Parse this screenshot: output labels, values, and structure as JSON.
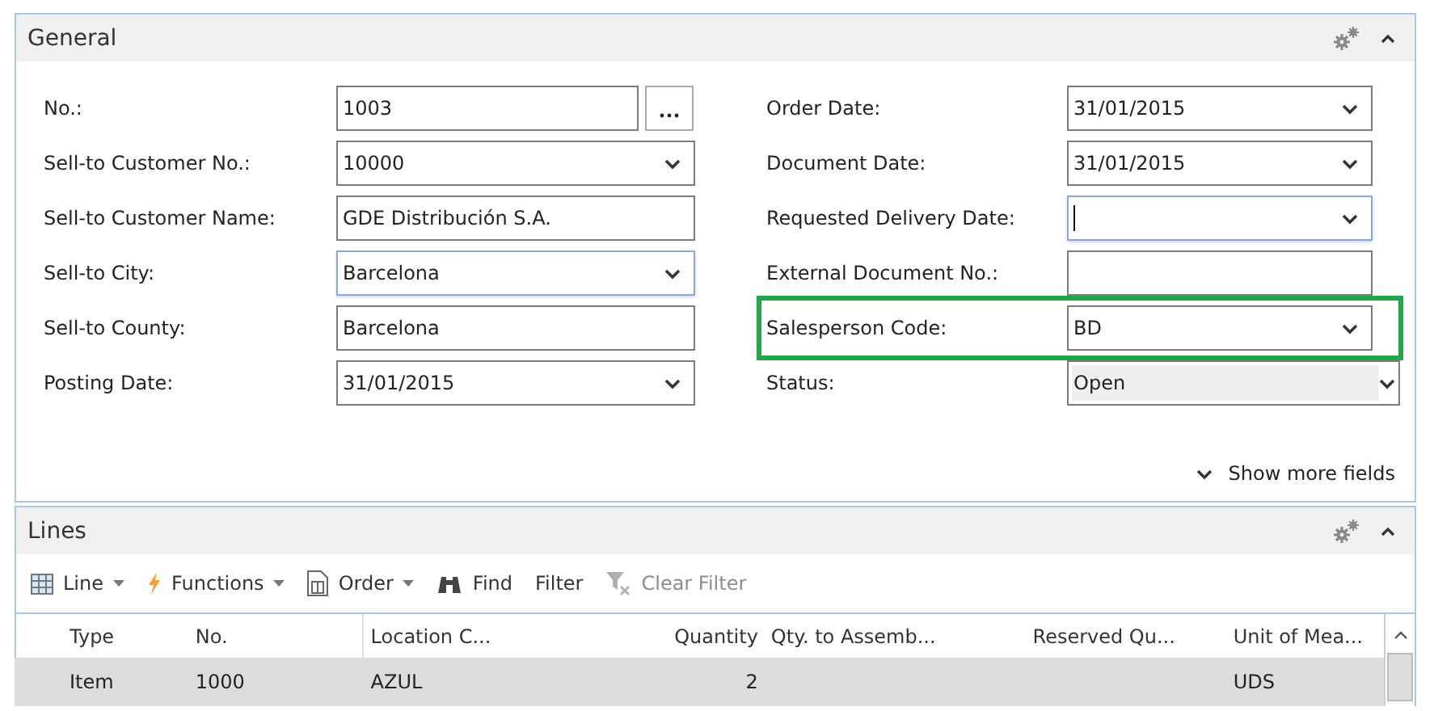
{
  "general": {
    "title": "General",
    "left_fields": [
      {
        "label": "No.:",
        "value": "1003",
        "kind": "lookup",
        "focused": false,
        "readonly": false,
        "highlighted": false
      },
      {
        "label": "Sell-to Customer No.:",
        "value": "10000",
        "kind": "dropdown",
        "focused": false,
        "readonly": false,
        "highlighted": false
      },
      {
        "label": "Sell-to Customer Name:",
        "value": "GDE Distribución S.A.",
        "kind": "text",
        "focused": false,
        "readonly": false,
        "highlighted": false
      },
      {
        "label": "Sell-to City:",
        "value": "Barcelona",
        "kind": "dropdown",
        "focused": true,
        "readonly": false,
        "highlighted": false
      },
      {
        "label": "Sell-to County:",
        "value": "Barcelona",
        "kind": "text",
        "focused": false,
        "readonly": false,
        "highlighted": false
      },
      {
        "label": "Posting Date:",
        "value": "31/01/2015",
        "kind": "dropdown",
        "focused": false,
        "readonly": false,
        "highlighted": false
      }
    ],
    "right_fields": [
      {
        "label": "Order Date:",
        "value": "31/01/2015",
        "kind": "dropdown",
        "focused": false,
        "readonly": false,
        "highlighted": false
      },
      {
        "label": "Document Date:",
        "value": "31/01/2015",
        "kind": "dropdown",
        "focused": false,
        "readonly": false,
        "highlighted": false
      },
      {
        "label": "Requested Delivery Date:",
        "kind": "dropdown",
        "focused": true,
        "readonly": false,
        "highlighted": false
      },
      {
        "label": "External Document No.:",
        "kind": "text",
        "focused": false,
        "readonly": false,
        "highlighted": false
      },
      {
        "label": "Salesperson Code:",
        "value": "BD",
        "kind": "dropdown",
        "focused": false,
        "readonly": false,
        "highlighted": true
      },
      {
        "label": "Status:",
        "value": "Open",
        "kind": "dropdown",
        "focused": false,
        "readonly": true,
        "highlighted": false
      }
    ],
    "show_more": "Show more fields"
  },
  "lines": {
    "title": "Lines",
    "toolbar": [
      {
        "label": "Line",
        "kind": "grid",
        "dropdown": true,
        "disabled": false
      },
      {
        "label": "Functions",
        "kind": "bolt",
        "dropdown": true,
        "disabled": false
      },
      {
        "label": "Order",
        "kind": "document",
        "dropdown": true,
        "disabled": false
      },
      {
        "label": "Find",
        "kind": "binoculars",
        "dropdown": false,
        "disabled": false
      },
      {
        "label": "Filter",
        "kind": "none",
        "dropdown": false,
        "disabled": false
      },
      {
        "label": "Clear Filter",
        "kind": "clear-filter",
        "dropdown": false,
        "disabled": true
      }
    ],
    "columns": [
      {
        "label": "Type",
        "kind": "text"
      },
      {
        "label": "No.",
        "kind": "text"
      },
      {
        "label": "Location C...",
        "kind": "text"
      },
      {
        "label": "Quantity",
        "kind": "number"
      },
      {
        "label": "Qty. to Assemb...",
        "kind": "text"
      },
      {
        "label": "Reserved Qu...",
        "kind": "text"
      },
      {
        "label": "Unit of Mea...",
        "kind": "text"
      }
    ],
    "rows": [
      {
        "selected": true,
        "cells": [
          "Item",
          "1000",
          "AZUL",
          "2",
          "",
          "",
          "UDS"
        ]
      }
    ]
  }
}
